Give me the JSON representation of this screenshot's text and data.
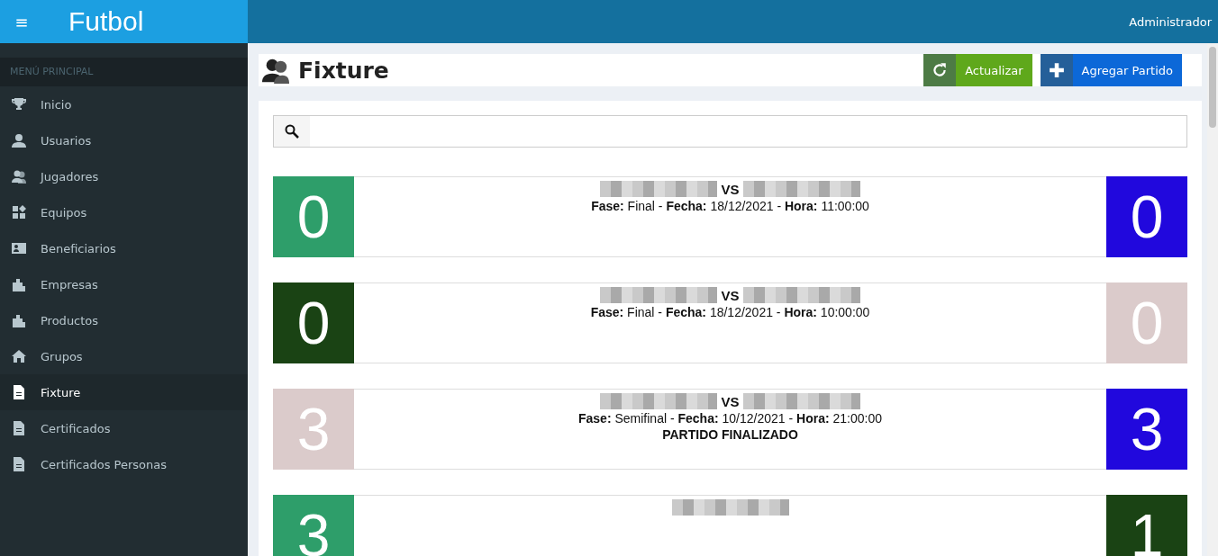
{
  "topbar": {
    "brand": "Futbol",
    "menu_glyph": "≡",
    "user": "Administrador"
  },
  "sidebar": {
    "header": "MENÚ PRINCIPAL",
    "items": [
      {
        "label": "Inicio",
        "kind": "trophy",
        "selected": false
      },
      {
        "label": "Usuarios",
        "kind": "user",
        "selected": false
      },
      {
        "label": "Jugadores",
        "kind": "users",
        "selected": false
      },
      {
        "label": "Equipos",
        "kind": "blocks",
        "selected": false
      },
      {
        "label": "Beneficiarios",
        "kind": "card",
        "selected": false
      },
      {
        "label": "Empresas",
        "kind": "building",
        "selected": false
      },
      {
        "label": "Productos",
        "kind": "building",
        "selected": false
      },
      {
        "label": "Grupos",
        "kind": "home",
        "selected": false
      },
      {
        "label": "Fixture",
        "kind": "doc",
        "selected": true
      },
      {
        "label": "Certificados",
        "kind": "doc",
        "selected": false
      },
      {
        "label": "Certificados Personas",
        "kind": "doc",
        "selected": false
      }
    ]
  },
  "page": {
    "title": "Fixture",
    "buttons": [
      {
        "label": "Actualizar",
        "kind": "refresh"
      },
      {
        "label": "Agregar Partido",
        "kind": "add"
      }
    ]
  },
  "matches": [
    {
      "teams": [
        {
          "score": "0",
          "color": "#2e9e6a"
        },
        {
          "score": "0",
          "color": "#2108dd"
        }
      ],
      "vs": "VS",
      "info": "**Fase:** Final - **Fecha:** 18/12/2021 - **Hora:** 11:00:00"
    },
    {
      "teams": [
        {
          "score": "0",
          "color": "#1a4314"
        },
        {
          "score": "0",
          "color": "#dbcbcb"
        }
      ],
      "vs": "VS",
      "info": "**Fase:** Final - **Fecha:** 18/12/2021 - **Hora:** 10:00:00"
    },
    {
      "teams": [
        {
          "score": "3",
          "color": "#dbcbcb"
        },
        {
          "score": "3",
          "color": "#2108dd"
        }
      ],
      "vs": "VS",
      "info": "**Fase:** Semifinal - **Fecha:** 10/12/2021 - **Hora:** 21:00:00",
      "status": "PARTIDO FINALIZADO"
    },
    {
      "teams": [
        {
          "score": "3",
          "color": "#2e9e6a"
        },
        {
          "score": "1",
          "color": "#1a4314"
        }
      ]
    }
  ]
}
